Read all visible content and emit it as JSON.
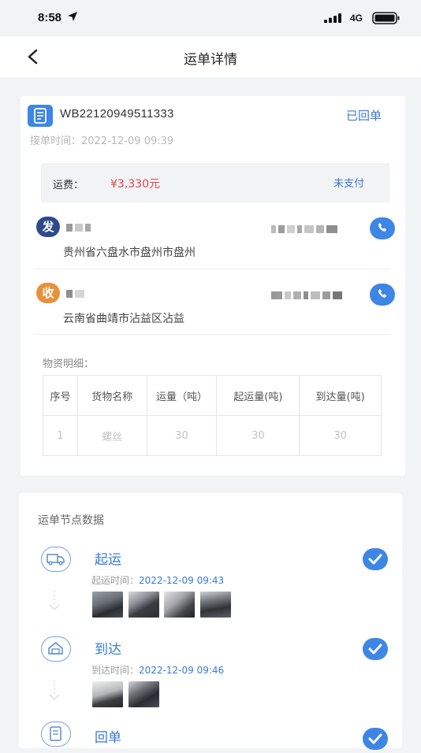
{
  "status_bar": {
    "time": "8:58",
    "network": "4G"
  },
  "header": {
    "title": "运单详情"
  },
  "waybill": {
    "number": "WB22120949511333",
    "status": "已回单",
    "accept_time_label": "接单时间：",
    "accept_time": "2022-12-09 09:39"
  },
  "fee": {
    "label": "运费：",
    "value": "¥3,330元",
    "status": "未支付"
  },
  "sender": {
    "badge": "发",
    "address": "贵州省六盘水市盘州市盘州"
  },
  "receiver": {
    "badge": "收",
    "address": "云南省曲靖市沾益区沾益"
  },
  "goods": {
    "title": "物资明细：",
    "headers": [
      "序号",
      "货物名称",
      "运量（吨）",
      "起运量(吨)",
      "到达量(吨)"
    ],
    "rows": [
      [
        "1",
        "螺丝",
        "30",
        "30",
        "30"
      ]
    ]
  },
  "nodes": {
    "title": "运单节点数据",
    "items": [
      {
        "name": "起运",
        "time_label": "起运时间：",
        "time": "2022-12-09 09:43",
        "icon": "truck-icon",
        "photos": 4
      },
      {
        "name": "到达",
        "time_label": "到达时间：",
        "time": "2022-12-09 09:46",
        "icon": "warehouse-icon",
        "photos": 2
      },
      {
        "name": "回单",
        "icon": "receipt-icon"
      }
    ]
  },
  "colors": {
    "accent": "#3d86e6",
    "link": "#3a7ad9",
    "price": "#e54545",
    "sender_badge": "#2c4a8a",
    "receiver_badge": "#e8913c"
  }
}
